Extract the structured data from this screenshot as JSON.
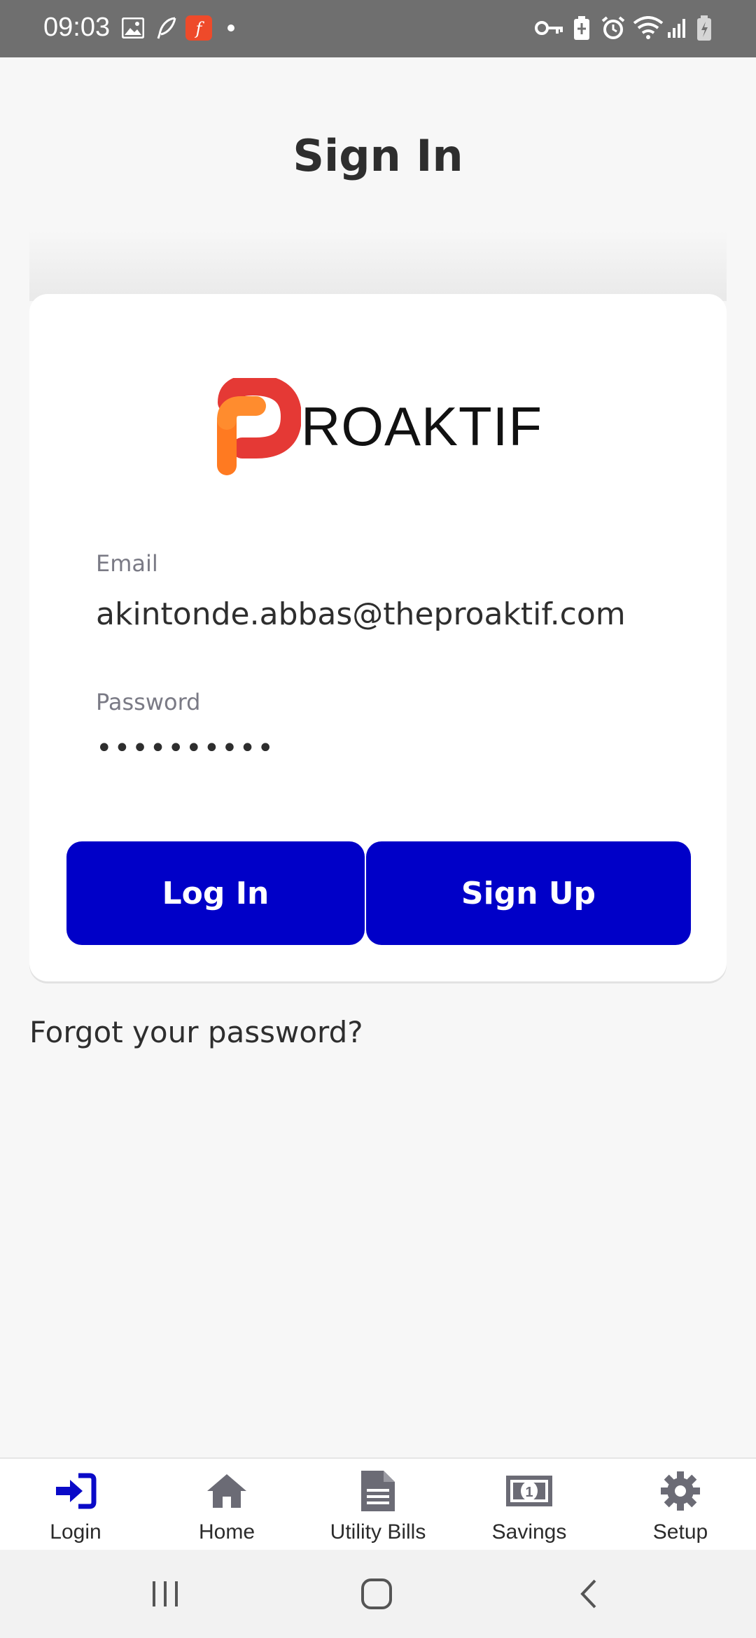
{
  "status_bar": {
    "time": "09:03",
    "left_icons": [
      "image-icon",
      "feather-icon",
      "app-f-icon",
      "dot-icon"
    ],
    "right_icons": [
      "vpn-key-icon",
      "battery-saver-icon",
      "alarm-icon",
      "wifi-icon",
      "signal-icon",
      "battery-icon"
    ]
  },
  "header": {
    "title": "Sign In"
  },
  "logo": {
    "text": "ROAKTIF",
    "colors": [
      "#e53935",
      "#ff7a21"
    ]
  },
  "form": {
    "email": {
      "label": "Email",
      "value": "akintonde.abbas@theproaktif.com"
    },
    "password": {
      "label": "Password",
      "value": "••••••••••"
    },
    "login_label": "Log In",
    "signup_label": "Sign Up",
    "button_color": "#0000c8"
  },
  "forgot_password": "Forgot your password?",
  "bottom_nav": {
    "active_color": "#0a0ac8",
    "inactive_color": "#6b6b75",
    "items": [
      {
        "label": "Login",
        "icon": "login-icon",
        "active": true
      },
      {
        "label": "Home",
        "icon": "home-icon",
        "active": false
      },
      {
        "label": "Utility Bills",
        "icon": "document-icon",
        "active": false
      },
      {
        "label": "Savings",
        "icon": "money-icon",
        "active": false
      },
      {
        "label": "Setup",
        "icon": "gear-icon",
        "active": false
      }
    ]
  },
  "system_nav": [
    "recents-icon",
    "home-circle-icon",
    "back-icon"
  ]
}
